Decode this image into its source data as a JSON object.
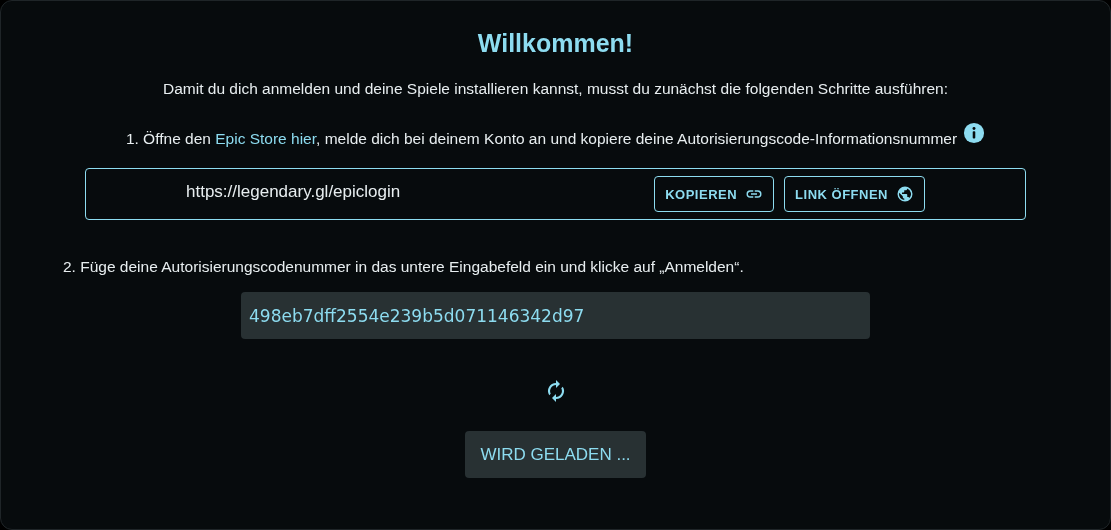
{
  "title": "Willkommen!",
  "intro": "Damit du dich anmelden und deine Spiele installieren kannst, musst du zunächst die folgenden Schritte ausführen:",
  "step1": {
    "before": "1. Öffne den ",
    "link": "Epic Store hier",
    "after": ", melde dich bei deinem Konto an und kopiere deine Autorisierungscode-Informationsnummer"
  },
  "url_box": {
    "url": "https://legendary.gl/epiclogin",
    "buttons": [
      {
        "label": "KOPIEREN",
        "kind": "copy"
      },
      {
        "label": "LINK ÖFFNEN",
        "kind": "open"
      }
    ]
  },
  "step2": "2. Füge deine Autorisierungscodenummer in das untere Eingabefeld ein und klicke auf „Anmelden“.",
  "code_field": {
    "value": "498eb7dff2554e239b5d071146342d97"
  },
  "loading": true,
  "submit_button": {
    "label": "WIRD GELADEN ...",
    "disabled": true
  }
}
